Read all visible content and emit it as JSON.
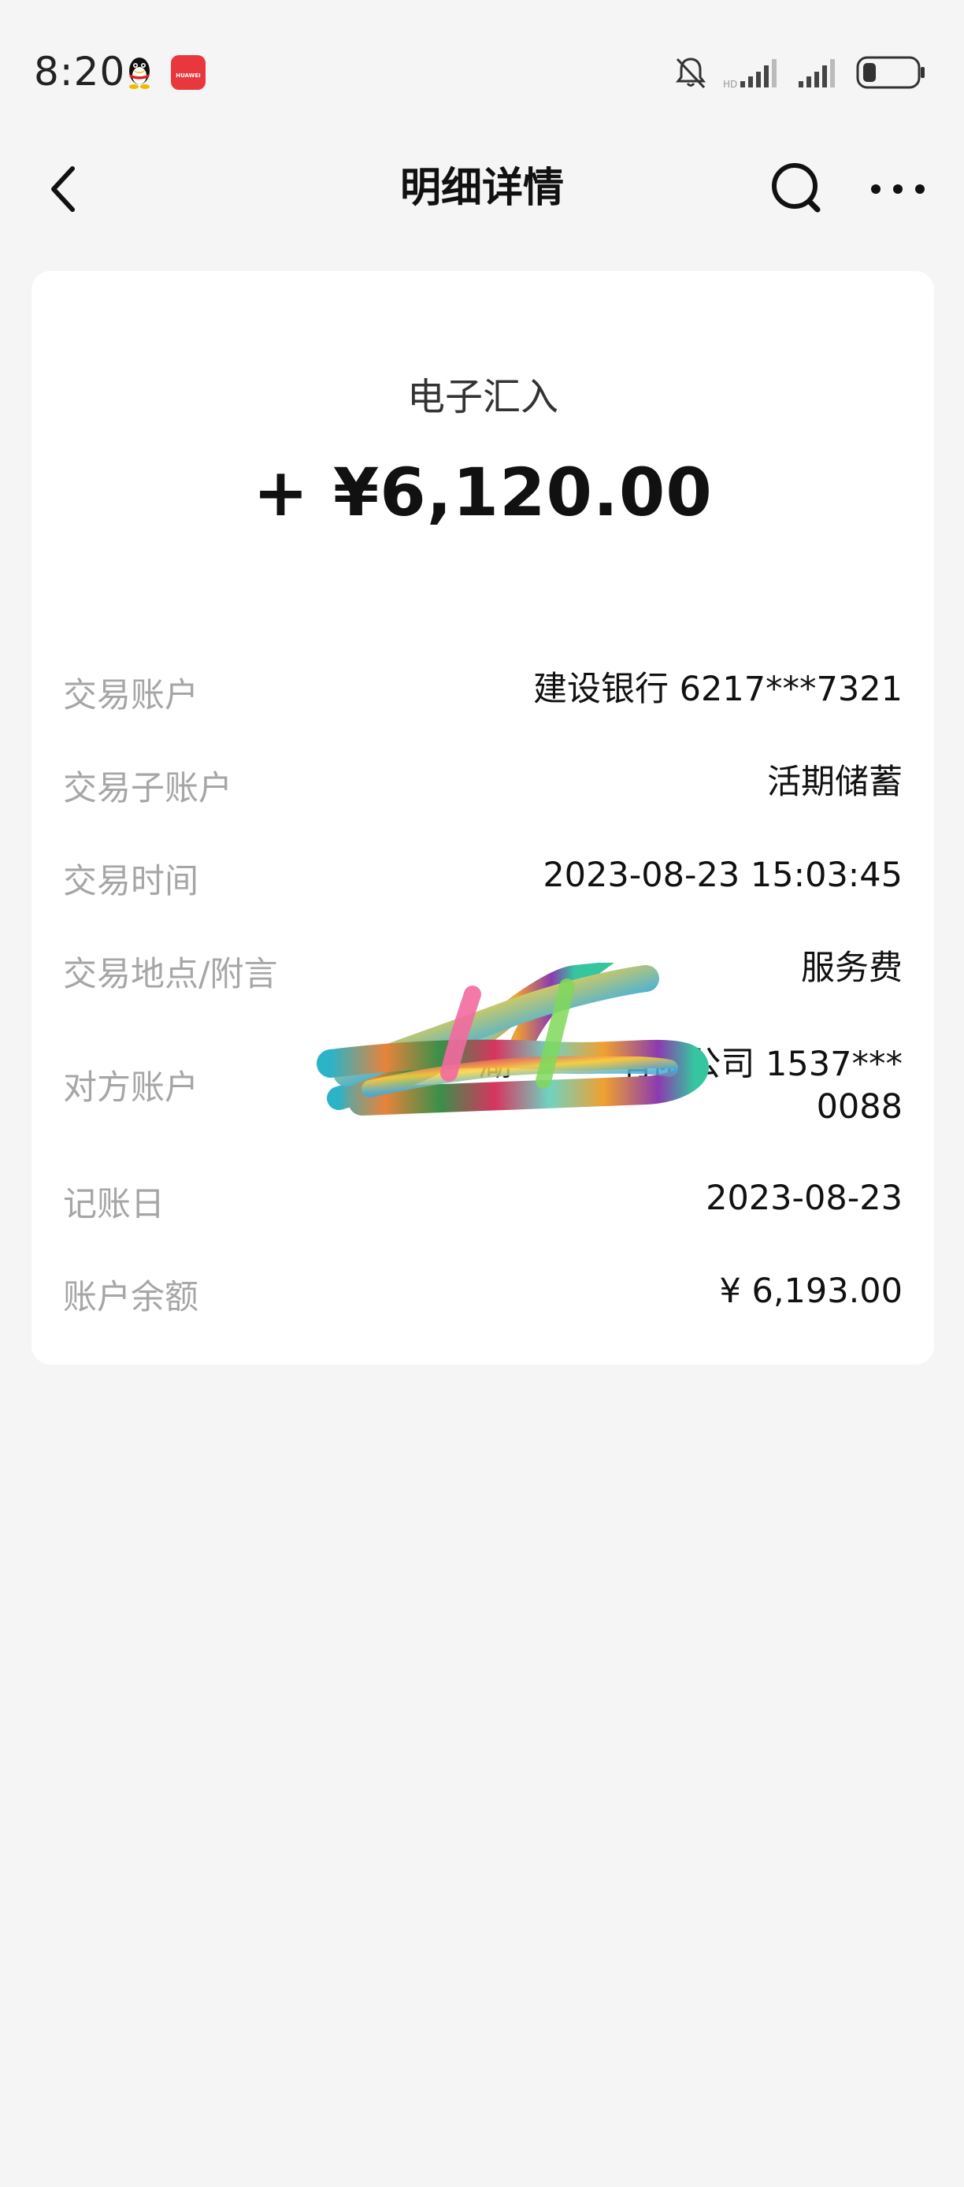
{
  "status_bar": {
    "time": "8:20",
    "icons": [
      "qq-icon",
      "huawei-app-icon",
      "bell-muted-icon",
      "signal-icon",
      "signal-icon",
      "battery-icon"
    ],
    "huawei_label": "HUAWEI"
  },
  "header": {
    "title": "明细详情",
    "back_icon": "chevron-left-icon",
    "search_icon": "search-icon",
    "more_icon": "more-horizontal-icon"
  },
  "transaction": {
    "type": "电子汇入",
    "amount": "+ ¥6,120.00"
  },
  "details": [
    {
      "label": "交易账户",
      "value": "建设银行 6217***7321"
    },
    {
      "label": "交易子账户",
      "value": "活期储蓄"
    },
    {
      "label": "交易时间",
      "value": "2023-08-23 15:03:45"
    },
    {
      "label": "交易地点/附言",
      "value": "服务费"
    },
    {
      "label": "对方账户",
      "value": "湖          有限公司 1537***",
      "value_line2": "0088"
    },
    {
      "label": "记账日",
      "value": "2023-08-23"
    },
    {
      "label": "账户余额",
      "value": "¥ 6,193.00"
    }
  ],
  "colors": {
    "background": "#f5f5f5",
    "card": "#ffffff",
    "label": "#a6a6a6",
    "value": "#111111"
  }
}
